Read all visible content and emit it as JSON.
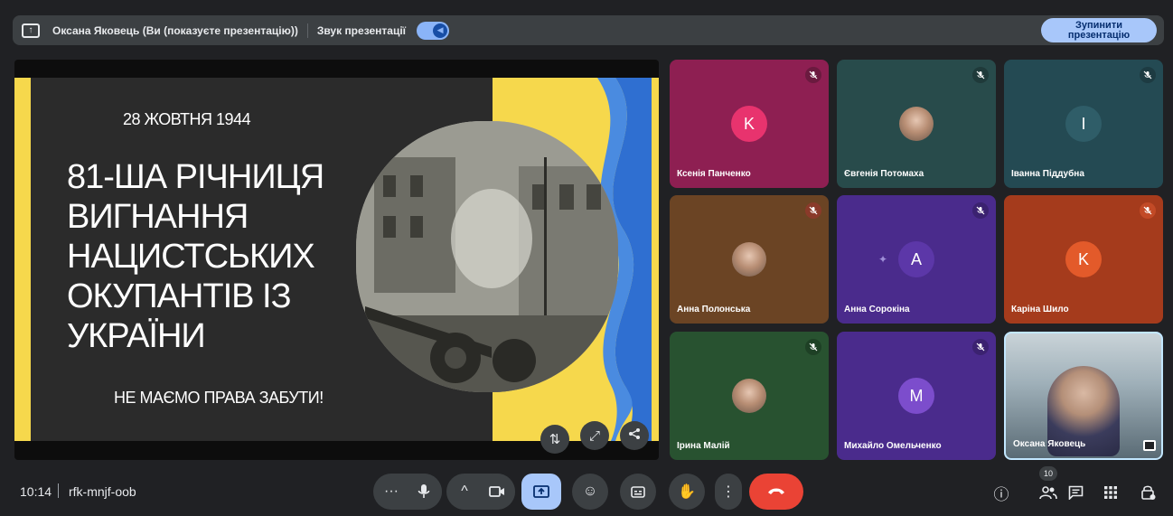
{
  "presenting_bar": {
    "presenter_text": "Оксана Яковець (Ви (показуєте презентацію))",
    "audio_label": "Звук презентації",
    "stop_button": "Зупинити презентацію"
  },
  "slide": {
    "date": "28 ЖОВТНЯ 1944",
    "title": "81-ША РІЧНИЦЯ ВИГНАННЯ НАЦИСТСЬКИХ ОКУПАНТІВ ІЗ УКРАЇНИ",
    "tagline": "НЕ МАЄМО ПРАВА ЗАБУТИ!"
  },
  "participants": [
    {
      "name": "Ксенія Панченко",
      "initial": "K",
      "bg": "#8e1f52",
      "avatar_bg": "#e8336e",
      "mute_bg": "#6b1a3f"
    },
    {
      "name": "Євгенія Потомаха",
      "initial": "",
      "bg": "#284b4b",
      "avatar_bg": "",
      "mute_bg": "#1f3a3a"
    },
    {
      "name": "Іванна Піддубна",
      "initial": "I",
      "bg": "#244a53",
      "avatar_bg": "#2f5d68",
      "mute_bg": "#1d3b42"
    },
    {
      "name": "Анна Полонська",
      "initial": "",
      "bg": "#6b4424",
      "avatar_bg": "",
      "mute_bg": "#8a3a2a"
    },
    {
      "name": "Анна Сорокіна",
      "initial": "A",
      "bg": "#4a2b8c",
      "avatar_bg": "#5c37a8",
      "mute_bg": "#3b2270"
    },
    {
      "name": "Каріна Шило",
      "initial": "K",
      "bg": "#a53b1c",
      "avatar_bg": "#e35a2a",
      "mute_bg": "#c24a26"
    },
    {
      "name": "Ірина Малій",
      "initial": "",
      "bg": "#285230",
      "avatar_bg": "",
      "mute_bg": "#1e4025"
    },
    {
      "name": "Михайло Омельченко",
      "initial": "M",
      "bg": "#4a2b8c",
      "avatar_bg": "#7c4dcc",
      "mute_bg": "#3b2270"
    },
    {
      "name": "Оксана Яковець",
      "initial": "",
      "bg": "#8a9aa3",
      "avatar_bg": "",
      "mute_bg": ""
    }
  ],
  "bottom": {
    "time": "10:14",
    "meeting_code": "rfk-mnjf-oob",
    "participant_count": "10"
  },
  "colors": {
    "accent_blue": "#8ab4f8",
    "end_call_red": "#ea4335",
    "present_active": "#a8c7fa"
  }
}
